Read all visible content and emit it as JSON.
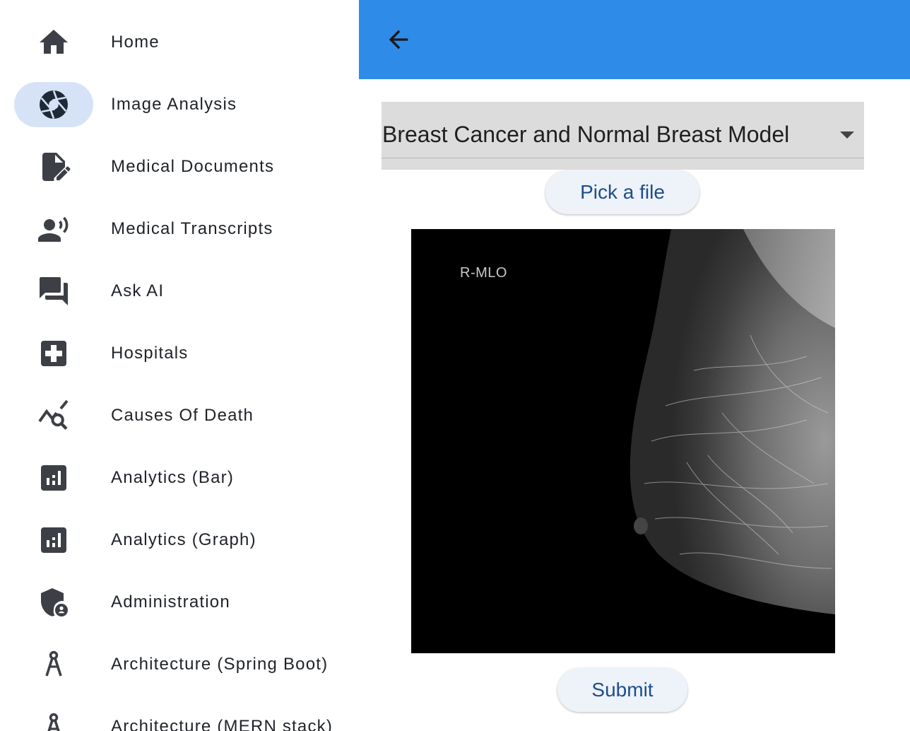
{
  "sidebar": {
    "items": [
      {
        "label": "Home",
        "icon": "home-icon",
        "active": false
      },
      {
        "label": "Image Analysis",
        "icon": "camera-aperture-icon",
        "active": true
      },
      {
        "label": "Medical Documents",
        "icon": "edit-document-icon",
        "active": false
      },
      {
        "label": "Medical Transcripts",
        "icon": "record-voice-icon",
        "active": false
      },
      {
        "label": "Ask AI",
        "icon": "chat-bubbles-icon",
        "active": false
      },
      {
        "label": "Hospitals",
        "icon": "medical-cross-icon",
        "active": false
      },
      {
        "label": "Causes Of Death",
        "icon": "query-stats-icon",
        "active": false
      },
      {
        "label": "Analytics (Bar)",
        "icon": "bar-chart-icon",
        "active": false
      },
      {
        "label": "Analytics (Graph)",
        "icon": "bar-chart-icon",
        "active": false
      },
      {
        "label": "Administration",
        "icon": "admin-shield-icon",
        "active": false
      },
      {
        "label": "Architecture (Spring Boot)",
        "icon": "architecture-compass-icon",
        "active": false
      },
      {
        "label": "Architecture (MERN stack)",
        "icon": "architecture-compass-icon",
        "active": false
      }
    ]
  },
  "appbar": {
    "back_icon": "arrow-back-icon",
    "color": "#2f8be8"
  },
  "model_select": {
    "value": "Breast Cancer and Normal Breast Model"
  },
  "pick_file": {
    "label": "Pick a file"
  },
  "preview": {
    "overlay_text": "R-MLO"
  },
  "submit": {
    "label": "Submit"
  },
  "colors": {
    "accent": "#2f8be8",
    "active_nav_bg": "#d6e3f7",
    "button_text": "#1d4f8a",
    "dropdown_bg": "#dcdcdc"
  }
}
